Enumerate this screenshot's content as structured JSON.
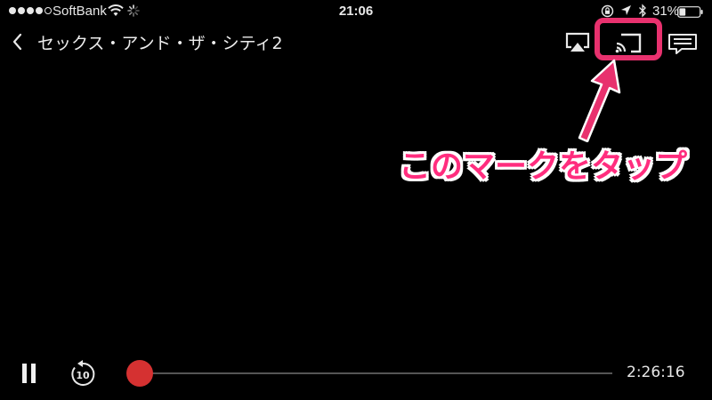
{
  "status_bar": {
    "signal_bars_filled": 4,
    "signal_bars_total": 5,
    "carrier": "SoftBank",
    "time": "21:06",
    "battery_percent": "31%",
    "battery_level": 0.31
  },
  "player": {
    "title": "セックス・アンド・ザ・シティ2",
    "time_remaining": "2:26:16",
    "progress": 0.01,
    "rewind_seconds": "10",
    "icons": {
      "back": "chevron-left-icon",
      "airplay": "airplay-icon",
      "cast": "cast-icon",
      "subtitles": "subtitles-icon",
      "pause": "pause-icon",
      "rewind": "rewind-10-icon"
    }
  },
  "annotation": {
    "callout_text": "このマークをタップ"
  },
  "colors": {
    "background": "#000000",
    "accent_red": "#d53131",
    "annotation_pink": "#e8316e",
    "callout_text": "#ff2d7e"
  }
}
